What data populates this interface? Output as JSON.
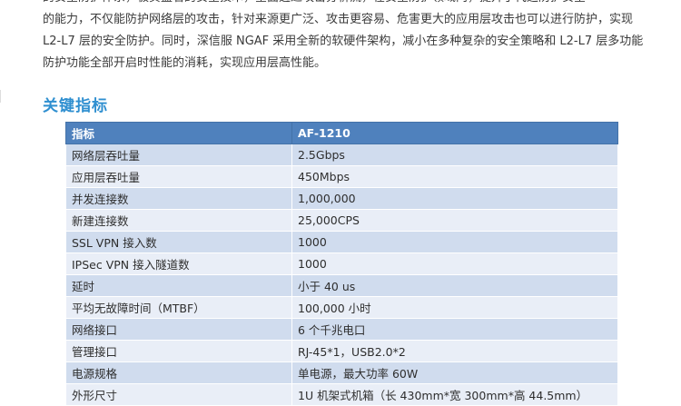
{
  "intro": {
    "line0": "的安全防护体系，极负盛名的安全技术，全面透过攻击分析流，在安全防护领域内，提升了代运防护安全",
    "line1": "的能力，不仅能防护网络层的攻击，针对来源更广泛、攻击更容易、危害更大的应用层攻击也可以进行防护，实现",
    "line2": "L2-L7 层的安全防护。同时，深信服 NGAF 采用全新的软硬件架构，减小在多种复杂的安全策略和 L2-L7 层多功能",
    "line3": "防护功能全部开启时性能的消耗，实现应用层高性能。"
  },
  "section_title": "关键指标",
  "table": {
    "header": [
      "指标",
      "AF-1210"
    ],
    "rows": [
      [
        "网络层吞吐量",
        "2.5Gbps"
      ],
      [
        "应用层吞吐量",
        "450Mbps"
      ],
      [
        "并发连接数",
        "1,000,000"
      ],
      [
        "新建连接数",
        "25,000CPS"
      ],
      [
        "SSL VPN 接入数",
        "1000"
      ],
      [
        "IPSec VPN 接入隧道数",
        "1000"
      ],
      [
        "延时",
        "小于 40 us"
      ],
      [
        "平均无故障时间（MTBF）",
        "100,000 小时"
      ],
      [
        "网络接口",
        "6 个千兆电口"
      ],
      [
        "管理接口",
        "RJ-45*1，USB2.0*2"
      ],
      [
        "电源规格",
        "单电源，最大功率 60W"
      ],
      [
        "外形尺寸",
        "1U 机架式机箱（长 430mm*宽 300mm*高 44.5mm）"
      ]
    ]
  }
}
